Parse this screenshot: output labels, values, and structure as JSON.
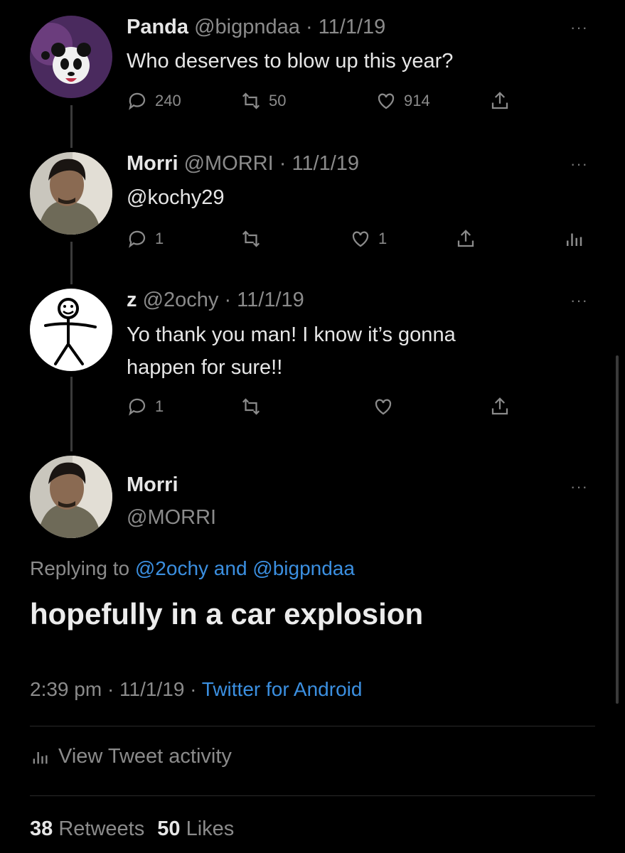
{
  "tweets": [
    {
      "name": "Panda",
      "handle": "@bigpndaa",
      "date": "· 11/1/19",
      "text": "Who deserves to blow up this year?",
      "replies": "240",
      "retweets": "50",
      "likes": "914"
    },
    {
      "name": "Morri",
      "handle": "@MORRI",
      "date": "· 11/1/19",
      "text": "@kochy29",
      "replies": "1",
      "retweets": "",
      "likes": "1"
    },
    {
      "name": "z",
      "handle": "@2ochy",
      "date": "· 11/1/19",
      "text_line1": "Yo thank you man! I know it’s gonna",
      "text_line2": "happen for sure!!",
      "replies": "1",
      "retweets": "",
      "likes": ""
    }
  ],
  "main_tweet": {
    "name": "Morri",
    "handle": "@MORRI",
    "replying_prefix": "Replying to",
    "replying_user1": "@2ochy",
    "replying_and": "and",
    "replying_user2": "@bigpndaa",
    "text": "hopefully in a car explosion",
    "time": "2:39 pm · 11/1/19 ·",
    "source": "Twitter for Android",
    "activity_label": "View Tweet activity",
    "retweets_count": "38",
    "retweets_label": "Retweets",
    "likes_count": "50",
    "likes_label": "Likes"
  },
  "ui": {
    "more_glyph": "···",
    "accent": "#3b8fe0",
    "background": "#000000"
  }
}
